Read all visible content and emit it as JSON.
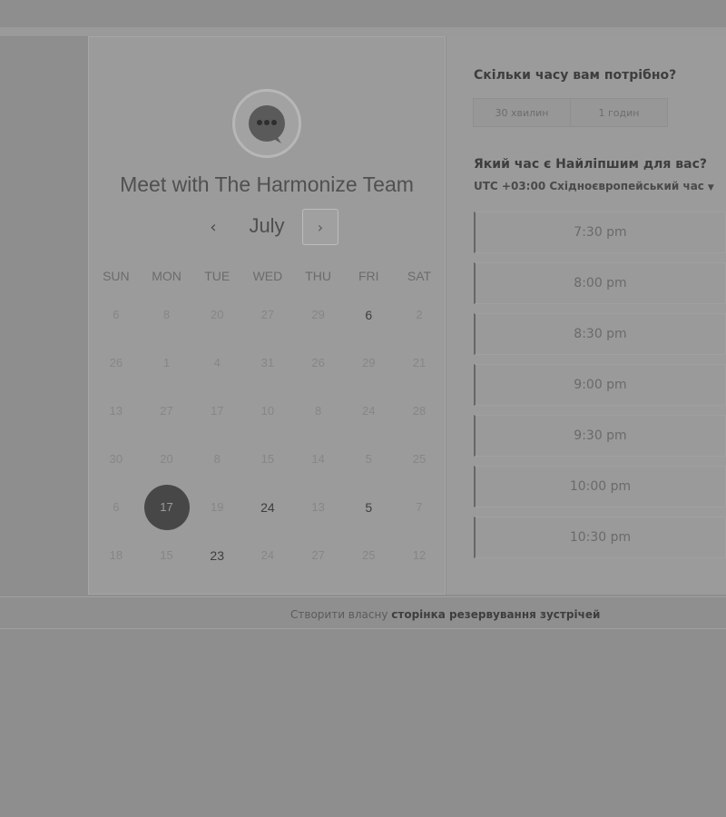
{
  "booking": {
    "title": "Meet with The Harmonize Team",
    "month": "July",
    "prev_icon": "‹",
    "next_icon": "›"
  },
  "calendar": {
    "weekdays": [
      "SUN",
      "MON",
      "TUE",
      "WED",
      "THU",
      "FRI",
      "SAT"
    ],
    "weeks": [
      [
        "6",
        "8",
        "20",
        "27",
        "29",
        "6",
        "2"
      ],
      [
        "26",
        "1",
        "4",
        "31",
        "26",
        "29",
        "21"
      ],
      [
        "13",
        "27",
        "17",
        "10",
        "8",
        "24",
        "28"
      ],
      [
        "30",
        "20",
        "8",
        "15",
        "14",
        "5",
        "25"
      ],
      [
        "6",
        "17",
        "19",
        "24",
        "13",
        "5",
        "7"
      ],
      [
        "18",
        "15",
        "23",
        "24",
        "27",
        "25",
        "12"
      ]
    ],
    "available": [
      "0-5",
      "4-3",
      "4-5",
      "5-2"
    ],
    "selected": "4-1"
  },
  "duration": {
    "question": "Скільки часу вам потрібно?",
    "options": [
      "30 хвилин",
      "1 годин"
    ]
  },
  "time": {
    "question": "Який час є Найліпшим для вас?",
    "timezone": "UTC +03:00 Східноєвропейський час",
    "slots": [
      "7:30 pm",
      "8:00 pm",
      "8:30 pm",
      "9:00 pm",
      "9:30 pm",
      "10:00 pm",
      "10:30 pm"
    ]
  },
  "footer": {
    "prefix": "Створити власну",
    "link": "сторінка резервування зустрічей"
  }
}
